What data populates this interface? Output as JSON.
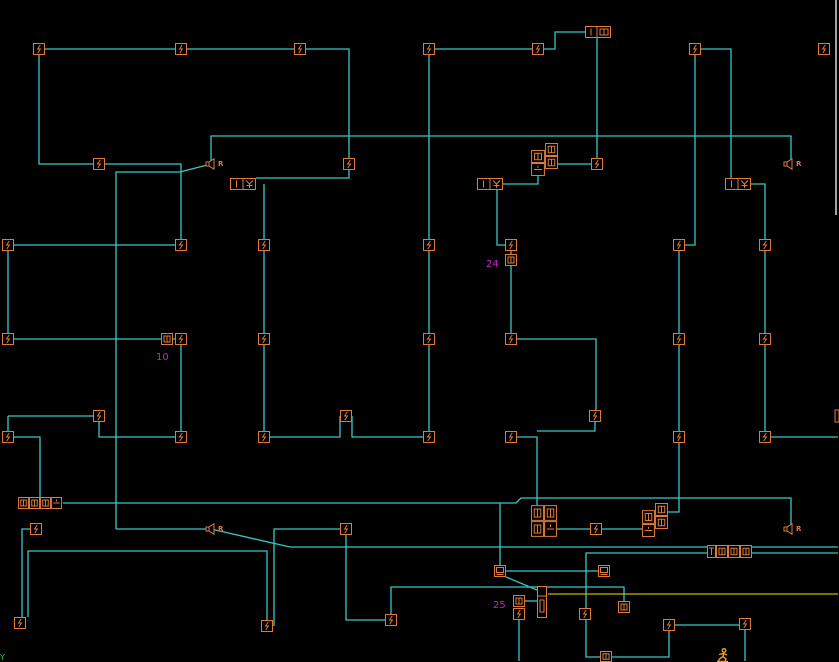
{
  "diagram": {
    "labels": {
      "zone_24": "24",
      "zone_10": "10",
      "zone_25": "25"
    },
    "speaker_tag": "R",
    "corner_mark": "Y"
  },
  "colors": {
    "background": "#000000",
    "wire": "#37c8c8",
    "device": "#e07a3a",
    "label": "#cc22cc",
    "highlight_wire": "#c8b400",
    "corner_mark": "#22cc22"
  },
  "icons": {
    "smoke_detector": "smoke-detector-icon",
    "speaker": "speaker-icon",
    "module": "io-module-icon",
    "device_cell": "device-cell-icon",
    "monitor": "monitor-icon",
    "manual_station": "person-icon"
  }
}
